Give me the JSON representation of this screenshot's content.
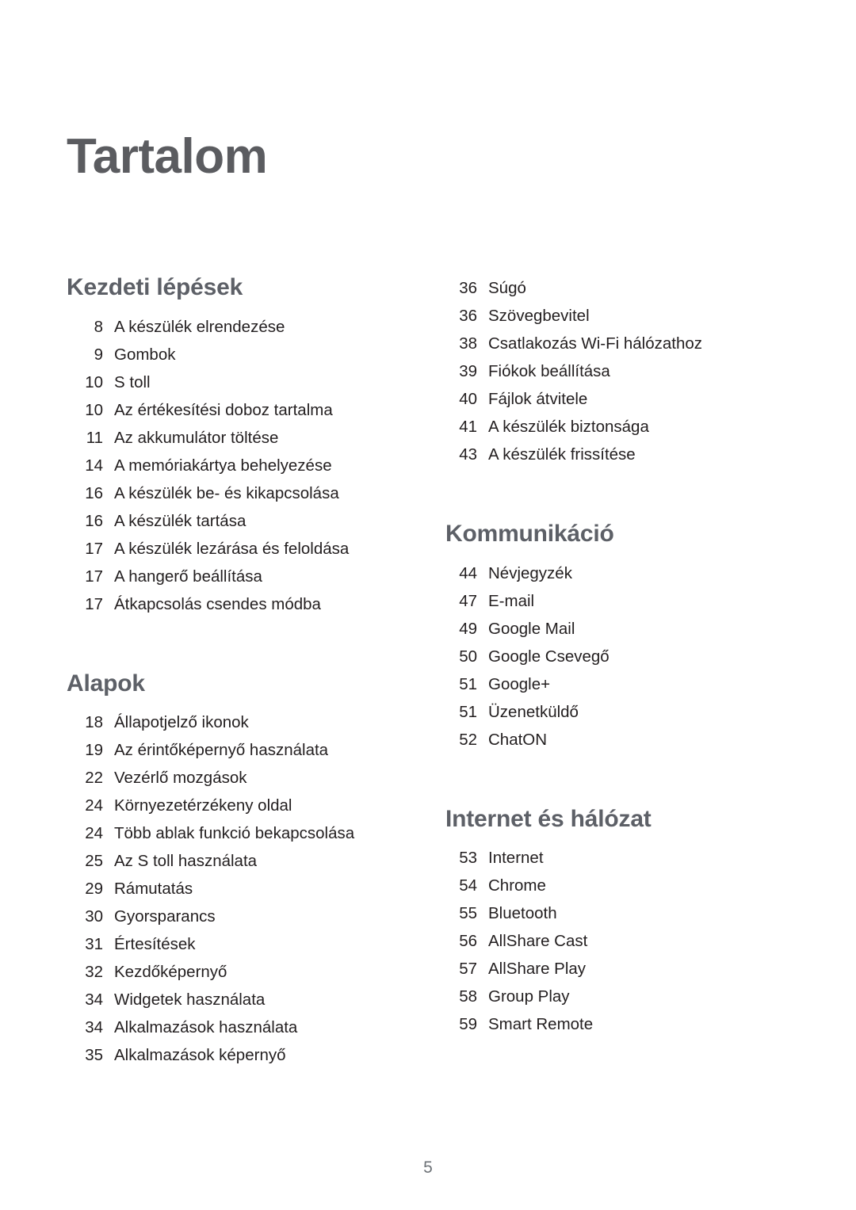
{
  "document": {
    "title": "Tartalom",
    "page_number": "5",
    "colors": {
      "title": "#5b5c60",
      "section_heading": "#5d6067",
      "body_text": "#231f20",
      "page_number": "#6d7277",
      "background": "#ffffff"
    }
  },
  "columns": {
    "left": {
      "sections": [
        {
          "heading": "Kezdeti lépések",
          "entries": [
            {
              "page": "8",
              "title": "A készülék elrendezése"
            },
            {
              "page": "9",
              "title": "Gombok"
            },
            {
              "page": "10",
              "title": "S toll"
            },
            {
              "page": "10",
              "title": "Az értékesítési doboz tartalma"
            },
            {
              "page": "11",
              "title": "Az akkumulátor töltése"
            },
            {
              "page": "14",
              "title": "A memóriakártya behelyezése"
            },
            {
              "page": "16",
              "title": "A készülék be- és kikapcsolása"
            },
            {
              "page": "16",
              "title": "A készülék tartása"
            },
            {
              "page": "17",
              "title": "A készülék lezárása és feloldása"
            },
            {
              "page": "17",
              "title": "A hangerő beállítása"
            },
            {
              "page": "17",
              "title": "Átkapcsolás csendes módba"
            }
          ]
        },
        {
          "heading": "Alapok",
          "entries": [
            {
              "page": "18",
              "title": "Állapotjelző ikonok"
            },
            {
              "page": "19",
              "title": "Az érintőképernyő használata"
            },
            {
              "page": "22",
              "title": "Vezérlő mozgások"
            },
            {
              "page": "24",
              "title": "Környezetérzékeny oldal"
            },
            {
              "page": "24",
              "title": "Több ablak funkció bekapcsolása"
            },
            {
              "page": "25",
              "title": "Az S toll használata"
            },
            {
              "page": "29",
              "title": "Rámutatás"
            },
            {
              "page": "30",
              "title": "Gyorsparancs"
            },
            {
              "page": "31",
              "title": "Értesítések"
            },
            {
              "page": "32",
              "title": "Kezdőképernyő"
            },
            {
              "page": "34",
              "title": "Widgetek használata"
            },
            {
              "page": "34",
              "title": "Alkalmazások használata"
            },
            {
              "page": "35",
              "title": "Alkalmazások képernyő"
            }
          ]
        }
      ]
    },
    "right": {
      "sections": [
        {
          "heading": "",
          "entries": [
            {
              "page": "36",
              "title": "Súgó"
            },
            {
              "page": "36",
              "title": "Szövegbevitel"
            },
            {
              "page": "38",
              "title": "Csatlakozás Wi-Fi hálózathoz"
            },
            {
              "page": "39",
              "title": "Fiókok beállítása"
            },
            {
              "page": "40",
              "title": "Fájlok átvitele"
            },
            {
              "page": "41",
              "title": "A készülék biztonsága"
            },
            {
              "page": "43",
              "title": "A készülék frissítése"
            }
          ]
        },
        {
          "heading": "Kommunikáció",
          "entries": [
            {
              "page": "44",
              "title": "Névjegyzék"
            },
            {
              "page": "47",
              "title": "E-mail"
            },
            {
              "page": "49",
              "title": "Google Mail"
            },
            {
              "page": "50",
              "title": "Google Csevegő"
            },
            {
              "page": "51",
              "title": "Google+"
            },
            {
              "page": "51",
              "title": "Üzenetküldő"
            },
            {
              "page": "52",
              "title": "ChatON"
            }
          ]
        },
        {
          "heading": "Internet és hálózat",
          "entries": [
            {
              "page": "53",
              "title": "Internet"
            },
            {
              "page": "54",
              "title": "Chrome"
            },
            {
              "page": "55",
              "title": "Bluetooth"
            },
            {
              "page": "56",
              "title": "AllShare Cast"
            },
            {
              "page": "57",
              "title": "AllShare Play"
            },
            {
              "page": "58",
              "title": "Group Play"
            },
            {
              "page": "59",
              "title": "Smart Remote"
            }
          ]
        }
      ]
    }
  }
}
